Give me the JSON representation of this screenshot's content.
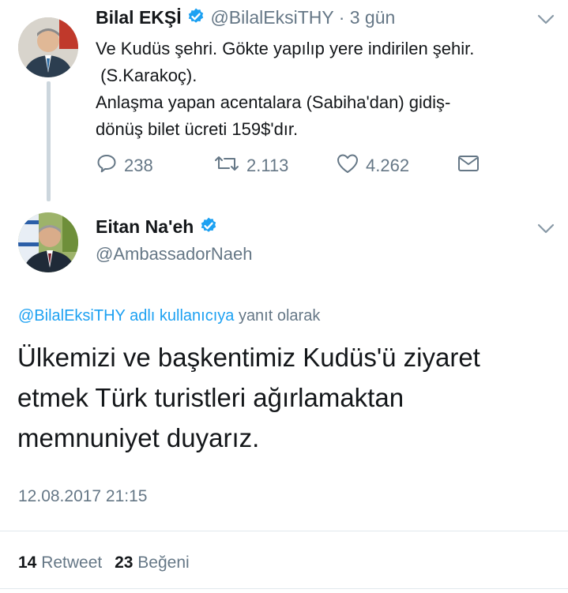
{
  "tweet1": {
    "name": "Bilal EKŞİ",
    "handle": "@BilalEksiTHY",
    "time": "· 3 gün",
    "lines": [
      "Ve Kudüs şehri. Gökte yapılıp yere indirilen şehir.",
      " (S.Karakoç).",
      "Anlaşma yapan acentalara (Sabiha'dan) gidiş-",
      "dönüş bilet ücreti 159$'dır."
    ],
    "replies": "238",
    "retweets": "2.113",
    "likes": "4.262"
  },
  "tweet2": {
    "name": "Eitan Na'eh",
    "handle": "@AmbassadorNaeh",
    "reply_to_link": "@BilalEksiTHY adlı kullanıcıya",
    "reply_to_suffix": "yanıt olarak",
    "lines": [
      "Ülkemizi ve başkentimiz Kudüs'ü ziyaret",
      "etmek Türk turistleri ağırlamaktan",
      "memnuniyet duyarız."
    ],
    "timestamp": "12.08.2017 21:15",
    "retweet_count": "14",
    "retweet_label": "Retweet",
    "like_count": "23",
    "like_label": "Beğeni"
  },
  "colors": {
    "accent": "#1da1f2",
    "muted": "#657786",
    "text": "#14171a",
    "divider": "#e1e8ed"
  },
  "icons": [
    "verified-badge-icon",
    "chevron-down-icon",
    "reply-icon",
    "retweet-icon",
    "heart-icon",
    "envelope-icon"
  ]
}
